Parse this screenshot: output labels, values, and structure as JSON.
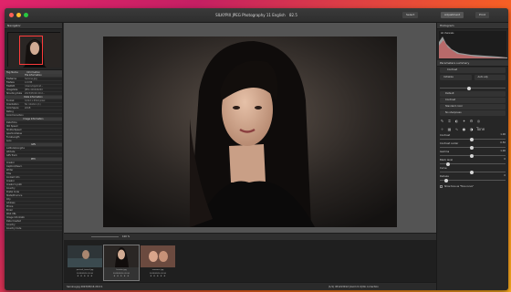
{
  "window": {
    "title": "SILKYPIX JPEG Photography 11 English",
    "zoom": "82.5"
  },
  "toolbar": {
    "select_label": "Select",
    "adjustment_label": "Adjustment",
    "print_label": "Print"
  },
  "left": {
    "navigator_title": "Navigator",
    "info_cols": [
      "Tag Name",
      "Information"
    ],
    "info_rows": [
      {
        "k": "File Information",
        "sec": true
      },
      {
        "k": "FileName",
        "v": "heroine.jpg"
      },
      {
        "k": "FileSize",
        "v": "4.9 MB"
      },
      {
        "k": "FilePath",
        "v": "/Users/Applicat..."
      },
      {
        "k": "ImageSize",
        "v": "JPEG 4160x6240"
      },
      {
        "k": "Shooting Date",
        "v": "2023/05/16 20:2..."
      },
      {
        "k": "Data Information",
        "sec": true
      },
      {
        "k": "Format",
        "v": "3,012 x 4512 pixel"
      },
      {
        "k": "Orientation",
        "v": "No rotation (1)"
      },
      {
        "k": "ColorSpace",
        "v": "sRGB"
      },
      {
        "k": "Rating",
        "v": ""
      },
      {
        "k": "ColorCorrection",
        "v": ""
      },
      {
        "k": "Image Information",
        "sec": true
      },
      {
        "k": "DateTime",
        "v": ""
      },
      {
        "k": "ISO Speed",
        "v": ""
      },
      {
        "k": "ShutterSpeed",
        "v": ""
      },
      {
        "k": "ApertureValue",
        "v": ""
      },
      {
        "k": "FocalLength",
        "v": ""
      },
      {
        "k": "Lens",
        "v": ""
      },
      {
        "k": "GPS",
        "sec": true
      },
      {
        "k": "Latitude/Longitude",
        "v": ""
      },
      {
        "k": "Altitude",
        "v": ""
      },
      {
        "k": "GPS Track",
        "v": ""
      },
      {
        "k": "IPTC",
        "sec": true
      },
      {
        "k": "Creator",
        "v": ""
      },
      {
        "k": "Caption/Descr.",
        "v": ""
      },
      {
        "k": "Writer",
        "v": ""
      },
      {
        "k": "Title",
        "v": ""
      },
      {
        "k": "Contact Info",
        "v": ""
      },
      {
        "k": "Creator",
        "v": ""
      },
      {
        "k": "Creator's Jobti",
        "v": ""
      },
      {
        "k": "Country",
        "v": ""
      },
      {
        "k": "Postal Code",
        "v": ""
      },
      {
        "k": "State/Province",
        "v": ""
      },
      {
        "k": "City",
        "v": ""
      },
      {
        "k": "Address",
        "v": ""
      },
      {
        "k": "Phone",
        "v": ""
      },
      {
        "k": "Email",
        "v": ""
      },
      {
        "k": "Web URL",
        "v": ""
      },
      {
        "k": "Image Information",
        "v": ""
      },
      {
        "k": "Date Created",
        "v": ""
      },
      {
        "k": "Country",
        "v": ""
      },
      {
        "k": "Country Code",
        "v": ""
      }
    ]
  },
  "center": {
    "strip_zoom": "100 %",
    "thumbs": [
      {
        "name": "portrait_tunnel.jpg",
        "date": "2023/05/16 20:16"
      },
      {
        "name": "heroine.jpg",
        "date": "2023/05/16 20:16"
      },
      {
        "name": "romance.jpg",
        "date": "2023/05/16 20:16"
      }
    ],
    "thumb_stars": "★ ★ ★ ★ ★",
    "status_left": "heroine.jpg 2023/05/16 20:2:1",
    "status_right": "(1/1) 4512x3012 [zoom 0.4] No correction"
  },
  "right": {
    "histogram_title": "Histogram",
    "histogram_channel": "All channels",
    "panel_title": "Parameters summary",
    "contrast_title": "Contrast",
    "btn_initialize": "Initialize",
    "btn_auto": "Auto adj.",
    "default_opt": "Default",
    "opt_contrast": "Contrast",
    "opt_standard": "Standard color",
    "opt_no_sharpness": "No sharpness",
    "tone_label": "Tone",
    "sliders": [
      {
        "label": "Contrast",
        "value": "1.00",
        "pos": 0.5
      },
      {
        "label": "Contrast center",
        "value": "0.50",
        "pos": 0.5
      },
      {
        "label": "Gamma",
        "value": "1.00",
        "pos": 0.5
      },
      {
        "label": "Black level",
        "value": "0",
        "pos": 0.1
      },
      {
        "label": "Curve",
        "value": "",
        "pos": 0.5
      },
      {
        "label": "Dehaze",
        "value": "0",
        "pos": 0.08
      }
    ],
    "show_tone_curve": "Show tone as \"Tone curve\""
  },
  "colors": {
    "red": "#ff5f57",
    "yellow": "#febc2e",
    "green": "#28c840",
    "accent": "#3b82f6"
  }
}
